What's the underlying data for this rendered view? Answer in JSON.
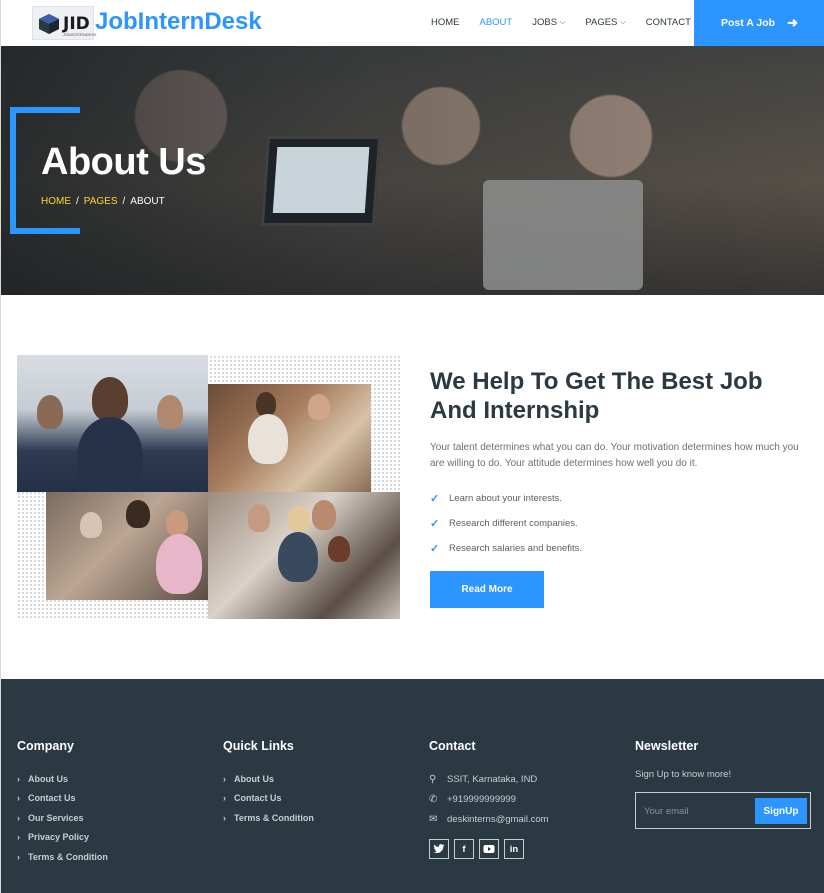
{
  "header": {
    "logo_text": "JID",
    "logo_subtext": "JOBINTERNDESK",
    "brand": "JobInternDesk",
    "nav": [
      {
        "label": "HOME",
        "active": false,
        "dropdown": false
      },
      {
        "label": "ABOUT",
        "active": true,
        "dropdown": false
      },
      {
        "label": "JOBS",
        "active": false,
        "dropdown": true
      },
      {
        "label": "PAGES",
        "active": false,
        "dropdown": true
      },
      {
        "label": "CONTACT",
        "active": false,
        "dropdown": false
      }
    ],
    "post_job": "Post A Job",
    "post_job_icon": "arrow-right-icon"
  },
  "hero": {
    "title": "About Us",
    "breadcrumb": [
      "HOME",
      "PAGES",
      "ABOUT"
    ],
    "separator": "/"
  },
  "about": {
    "heading": "We Help To Get The Best Job And Internship",
    "paragraph": "Your talent determines what you can do. Your motivation determines how much you are willing to do. Your attitude determines how well you do it.",
    "bullets": [
      "Learn about your interests.",
      "Research different companies.",
      "Research salaries and benefits."
    ],
    "read_more": "Read More"
  },
  "footer": {
    "company": {
      "title": "Company",
      "links": [
        "About Us",
        "Contact Us",
        "Our Services",
        "Privacy Policy",
        "Terms & Condition"
      ]
    },
    "quick_links": {
      "title": "Quick Links",
      "links": [
        "About Us",
        "Contact Us",
        "Terms & Condition"
      ]
    },
    "contact": {
      "title": "Contact",
      "address": "SSIT, Karnataka, IND",
      "phone": "+919999999999",
      "email": "deskinterns@gmail.com",
      "socials": [
        "twitter-icon",
        "facebook-icon",
        "youtube-icon",
        "linkedin-icon"
      ]
    },
    "newsletter": {
      "title": "Newsletter",
      "text": "Sign Up to know more!",
      "placeholder": "Your email",
      "button": "SignUp"
    }
  },
  "colors": {
    "accent": "#2d95ff",
    "footer_bg": "#2b3942",
    "breadcrumb_link": "#ffd43b"
  }
}
